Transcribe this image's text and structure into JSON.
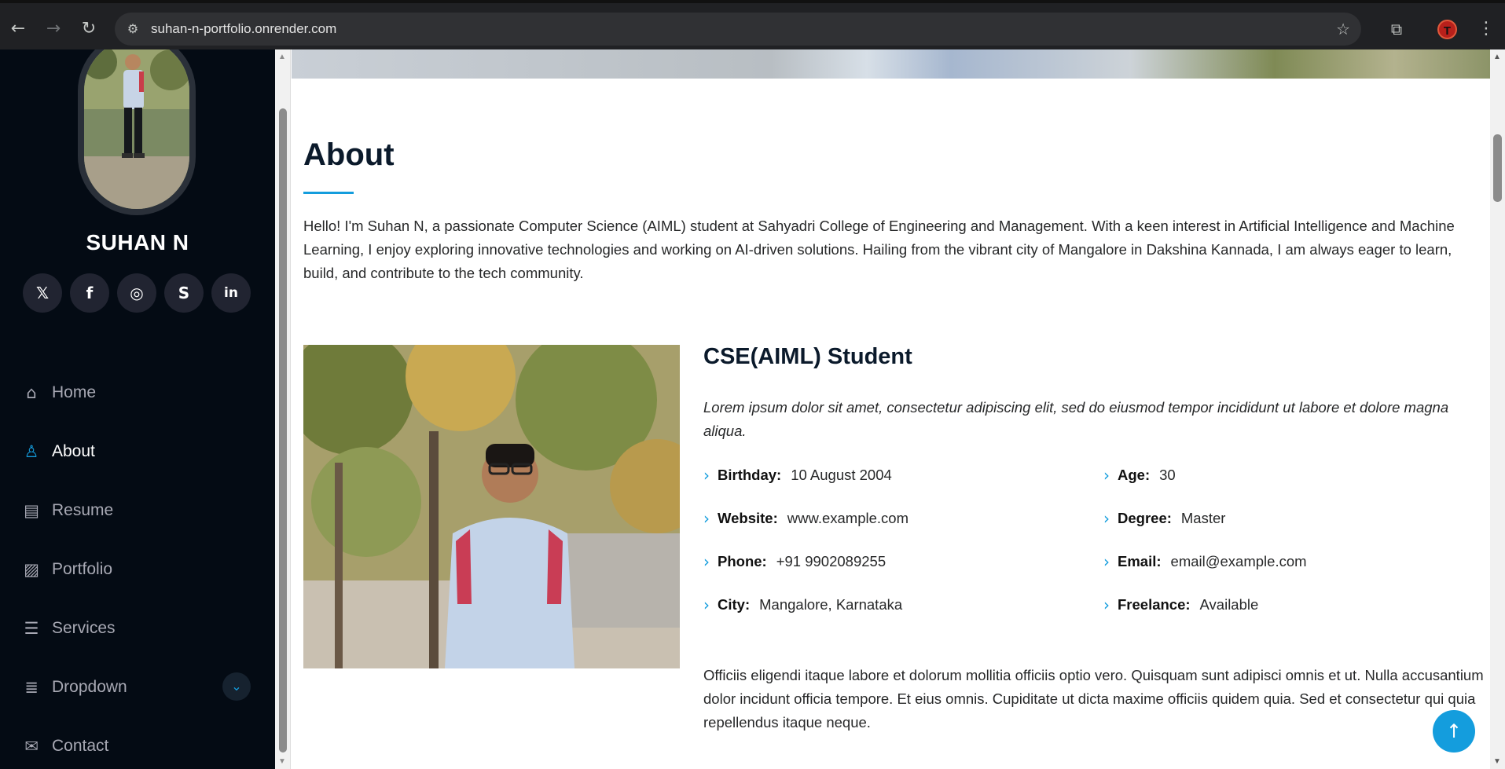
{
  "browser": {
    "url": "suhan-n-portfolio.onrender.com",
    "profile_initial": "T"
  },
  "sidebar": {
    "name": "SUHAN N",
    "socials": [
      {
        "icon": "x-twitter-icon",
        "glyph": "𝕏"
      },
      {
        "icon": "facebook-icon",
        "glyph": "f"
      },
      {
        "icon": "instagram-icon",
        "glyph": "◎"
      },
      {
        "icon": "skype-icon",
        "glyph": "S"
      },
      {
        "icon": "linkedin-icon",
        "glyph": "in"
      }
    ],
    "menu": [
      {
        "label": "Home",
        "icon": "home-icon",
        "active": false
      },
      {
        "label": "About",
        "icon": "person-icon",
        "active": true
      },
      {
        "label": "Resume",
        "icon": "file-text-icon",
        "active": false
      },
      {
        "label": "Portfolio",
        "icon": "images-icon",
        "active": false
      },
      {
        "label": "Services",
        "icon": "hdd-stack-icon",
        "active": false
      },
      {
        "label": "Dropdown",
        "icon": "menu-list-icon",
        "active": false,
        "has_dropdown": true
      },
      {
        "label": "Contact",
        "icon": "envelope-icon",
        "active": false
      }
    ]
  },
  "about": {
    "title": "About",
    "intro": "Hello! I'm Suhan N, a passionate Computer Science (AIML) student at Sahyadri College of Engineering and Management. With a keen interest in Artificial Intelligence and Machine Learning, I enjoy exploring innovative technologies and working on AI-driven solutions. Hailing from the vibrant city of Mangalore in Dakshina Kannada, I am always eager to learn, build, and contribute to the tech community.",
    "role": "CSE(AIML) Student",
    "lead": "Lorem ipsum dolor sit amet, consectetur adipiscing elit, sed do eiusmod tempor incididunt ut labore et dolore magna aliqua.",
    "facts_left": [
      {
        "key": "Birthday:",
        "value": "10 August 2004"
      },
      {
        "key": "Website:",
        "value": "www.example.com"
      },
      {
        "key": "Phone:",
        "value": "+91 9902089255"
      },
      {
        "key": "City:",
        "value": "Mangalore, Karnataka"
      }
    ],
    "facts_right": [
      {
        "key": "Age:",
        "value": "30"
      },
      {
        "key": "Degree:",
        "value": "Master"
      },
      {
        "key": "Email:",
        "value": "email@example.com"
      },
      {
        "key": "Freelance:",
        "value": "Available"
      }
    ],
    "outro": "Officiis eligendi itaque labore et dolorum mollitia officiis optio vero. Quisquam sunt adipisci omnis et ut. Nulla accusantium dolor incidunt officia tempore. Et eius omnis. Cupiditate ut dicta maxime officiis quidem quia. Sed et consectetur qui quia repellendus itaque neque."
  },
  "colors": {
    "accent": "#149ddd",
    "sidebar_bg": "#040b14"
  }
}
